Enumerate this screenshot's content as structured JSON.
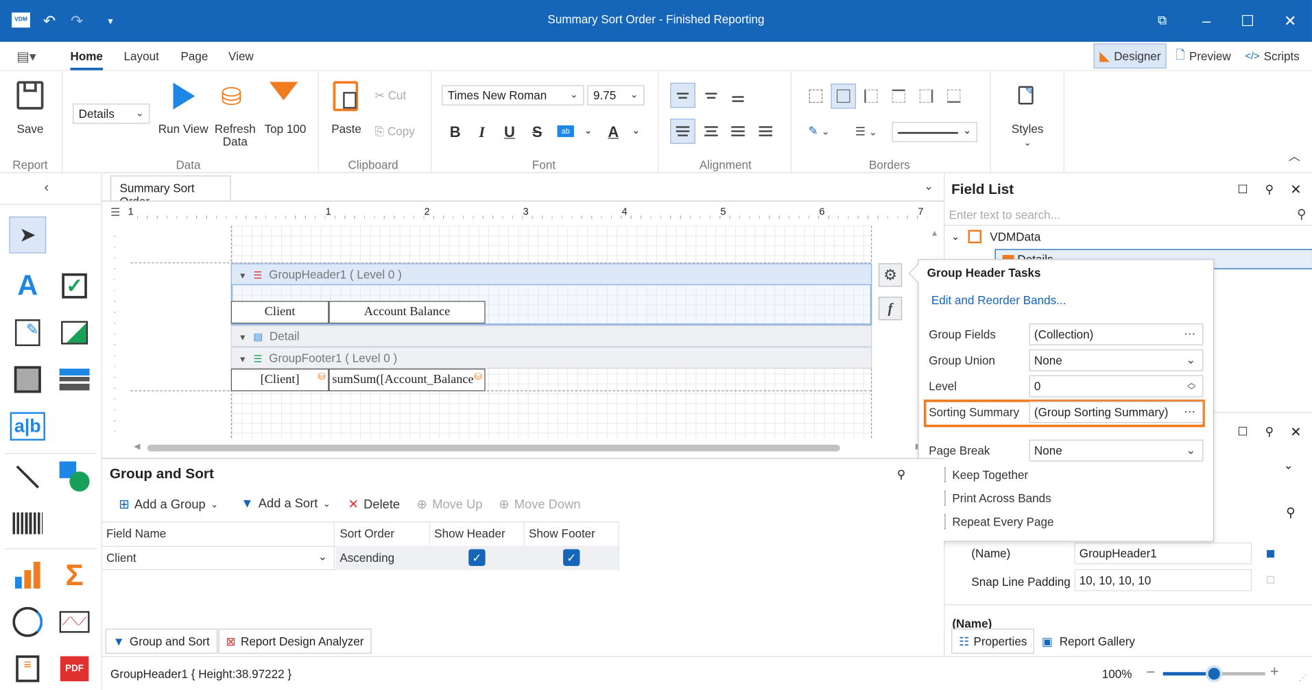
{
  "window": {
    "title": "Summary Sort Order - Finished Reporting",
    "app_badge": "VDM"
  },
  "menu": {
    "tabs": [
      "Home",
      "Layout",
      "Page",
      "View"
    ],
    "active": "Home",
    "right_buttons": [
      {
        "label": "Designer",
        "icon": "designer-icon",
        "selected": true
      },
      {
        "label": "Preview",
        "icon": "preview-icon"
      },
      {
        "label": "Scripts",
        "icon": "scripts-icon"
      }
    ]
  },
  "ribbon": {
    "report": {
      "save": "Save",
      "group": "Report"
    },
    "data": {
      "band_combo": "Details",
      "run_view": "Run View",
      "refresh": "Refresh Data",
      "top100": "Top 100",
      "group": "Data"
    },
    "clipboard": {
      "paste": "Paste",
      "cut": "Cut",
      "copy": "Copy",
      "group": "Clipboard"
    },
    "font": {
      "family": "Times New Roman",
      "size": "9.75",
      "group": "Font",
      "bold": "B",
      "italic": "I",
      "underline": "U",
      "strike": "S",
      "color_letter": "A",
      "highlight": "ab"
    },
    "alignment": {
      "group": "Alignment"
    },
    "borders": {
      "group": "Borders"
    },
    "styles": {
      "label": "Styles"
    }
  },
  "document": {
    "tab": "Summary Sort Order",
    "ruler": [
      "1",
      "1",
      "2",
      "3",
      "4",
      "5",
      "6",
      "7"
    ],
    "bands": {
      "group_header": "GroupHeader1 ( Level 0 )",
      "detail": "Detail",
      "group_footer": "GroupFooter1 ( Level 0 )"
    },
    "cells": {
      "client_hdr": "Client",
      "balance_hdr": "Account Balance",
      "client_val": "[Client]",
      "balance_val": "sumSum([Account_Balance"
    }
  },
  "popup": {
    "title": "Group Header Tasks",
    "link": "Edit and Reorder Bands...",
    "rows": {
      "group_fields": {
        "label": "Group Fields",
        "value": "(Collection)"
      },
      "group_union": {
        "label": "Group Union",
        "value": "None"
      },
      "level": {
        "label": "Level",
        "value": "0"
      },
      "sorting_summary": {
        "label": "Sorting Summary",
        "value": "(Group Sorting Summary)"
      },
      "page_break": {
        "label": "Page Break",
        "value": "None"
      }
    },
    "checks": {
      "keep_together": "Keep Together",
      "print_across": "Print Across Bands",
      "repeat_every": "Repeat Every Page"
    },
    "highlight_color": "#f07c1f"
  },
  "field_list": {
    "title": "Field List",
    "search_placeholder": "Enter text to search...",
    "root": "VDMData",
    "child": "Details"
  },
  "properties": {
    "name_label": "(Name)",
    "name_value": "GroupHeader1",
    "snap_label": "Snap Line Padding",
    "snap_value": "10, 10, 10, 10",
    "desc_title": "(Name)",
    "tab_properties": "Properties",
    "tab_gallery": "Report Gallery"
  },
  "group_sort": {
    "title": "Group and Sort",
    "add_group": "Add a Group",
    "add_sort": "Add a Sort",
    "delete": "Delete",
    "move_up": "Move Up",
    "move_down": "Move Down",
    "columns": [
      "Field Name",
      "Sort Order",
      "Show Header",
      "Show Footer"
    ],
    "rows": [
      {
        "field": "Client",
        "order": "Ascending",
        "show_header": true,
        "show_footer": true
      }
    ]
  },
  "bottom_tabs": [
    "Group and Sort",
    "Report Design Analyzer"
  ],
  "status": {
    "text": "GroupHeader1 { Height:38.97222 }",
    "zoom": "100%",
    "zoom_level": 0.5
  }
}
